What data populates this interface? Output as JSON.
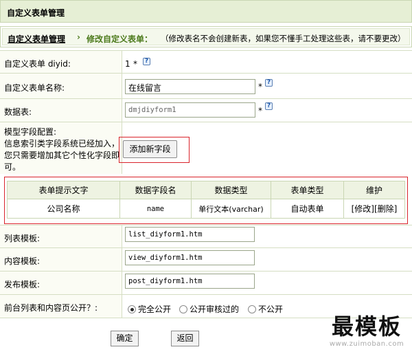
{
  "header": {
    "title": "自定义表单管理"
  },
  "breadcrumb": {
    "root": "自定义表单管理",
    "separator": "›",
    "current": "修改自定义表单：",
    "note": "（修改表名不会创建新表，如果您不懂手工处理这些表，请不要更改）"
  },
  "form": {
    "diyid": {
      "label": "自定义表单 diyid:",
      "value": "1",
      "required": "*",
      "help": "?"
    },
    "name": {
      "label": "自定义表单名称:",
      "value": "在线留言",
      "required": "*",
      "help": "?"
    },
    "table": {
      "label": "数据表:",
      "placeholder": "dmjdiyform1",
      "required": "*",
      "help": "?"
    },
    "model_fields": {
      "label_line1": "模型字段配置:",
      "label_line2": "信息索引类字段系统已经加入，",
      "label_line3": "您只需要增加其它个性化字段即",
      "label_line4": "可。",
      "add_button": "添加新字段"
    },
    "fields_table": {
      "headers": [
        "表单提示文字",
        "数据字段名",
        "数据类型",
        "表单类型",
        "维护"
      ],
      "rows": [
        {
          "prompt": "公司名称",
          "field": "name",
          "data_type": "单行文本(varchar)",
          "form_type": "自动表单",
          "edit": "[修改]",
          "delete": "[删除]"
        }
      ]
    },
    "list_template": {
      "label": "列表模板:",
      "value": "list_diyform1.htm"
    },
    "view_template": {
      "label": "内容模板:",
      "value": "view_diyform1.htm"
    },
    "post_template": {
      "label": "发布模板:",
      "value": "post_diyform1.htm"
    },
    "public": {
      "label": "前台列表和内容页公开？:",
      "options": [
        "完全公开",
        "公开审核过的",
        "不公开"
      ],
      "selected": "完全公开"
    }
  },
  "actions": {
    "confirm": "确定",
    "back": "返回"
  },
  "watermark": {
    "text": "最模板",
    "url": "www.zuimoban.com"
  }
}
